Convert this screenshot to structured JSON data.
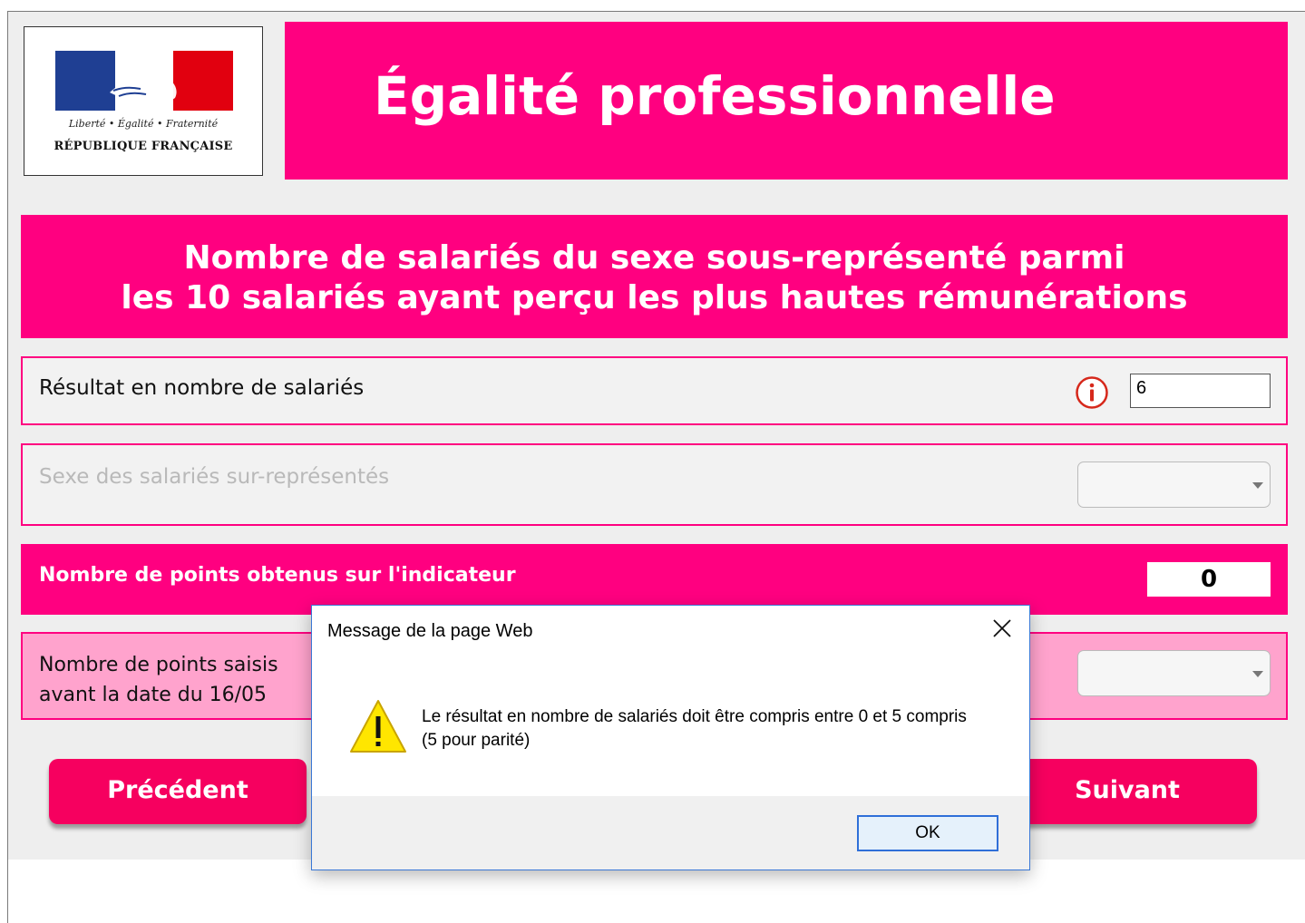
{
  "header": {
    "logo": {
      "motto": "Liberté • Égalité • Fraternité",
      "republic": "RÉPUBLIQUE FRANÇAISE",
      "flag_colors": [
        "#1f3f93",
        "#ffffff",
        "#e1000f"
      ]
    },
    "title": "Égalité professionnelle"
  },
  "section": {
    "title_line1": "Nombre de salariés du sexe sous-représenté parmi",
    "title_line2": "les 10 salariés ayant perçu les plus hautes rémunérations"
  },
  "form": {
    "result": {
      "label": "Résultat en nombre de salariés",
      "value": "6",
      "info_icon": "info-icon"
    },
    "sexe": {
      "label": "Sexe des salariés sur-représentés",
      "selected": ""
    },
    "points": {
      "label": "Nombre de points obtenus sur l'indicateur",
      "value": "0"
    },
    "saisis": {
      "label_line1": "Nombre de points saisis",
      "label_line2": "avant la date du 16/05",
      "selected": ""
    }
  },
  "navigation": {
    "prev_label": "Précédent",
    "next_label": "Suivant"
  },
  "dialog": {
    "title": "Message de la page Web",
    "message": "Le résultat en nombre de salariés doit être compris entre 0 et 5 compris (5 pour parité)",
    "ok_label": "OK",
    "icon": "warning-icon"
  },
  "colors": {
    "brand_pink": "#ff0080",
    "light_pink": "#ffa3cd",
    "button_pink": "#f6005f",
    "panel_gray": "#eeeeee",
    "dialog_border": "#3a78d6"
  }
}
